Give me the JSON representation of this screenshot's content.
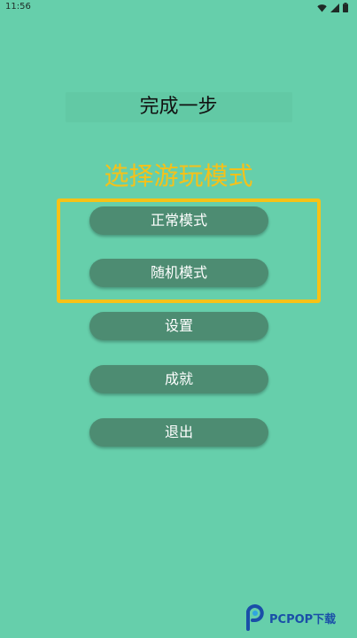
{
  "status_bar": {
    "time": "11:56",
    "icons": [
      "wifi-icon",
      "signal-icon",
      "battery-icon"
    ]
  },
  "title": "完成一步",
  "mode_heading": "选择游玩模式",
  "menu": {
    "normal_mode": "正常模式",
    "random_mode": "随机模式",
    "settings": "设置",
    "achievements": "成就",
    "exit": "退出"
  },
  "watermark": {
    "text": "PCPOP下载",
    "icon": "pcpop-logo-icon"
  },
  "colors": {
    "background": "#66CFAB",
    "button": "#4D8C72",
    "highlight": "#F7C217",
    "heading": "#F5C11A"
  }
}
